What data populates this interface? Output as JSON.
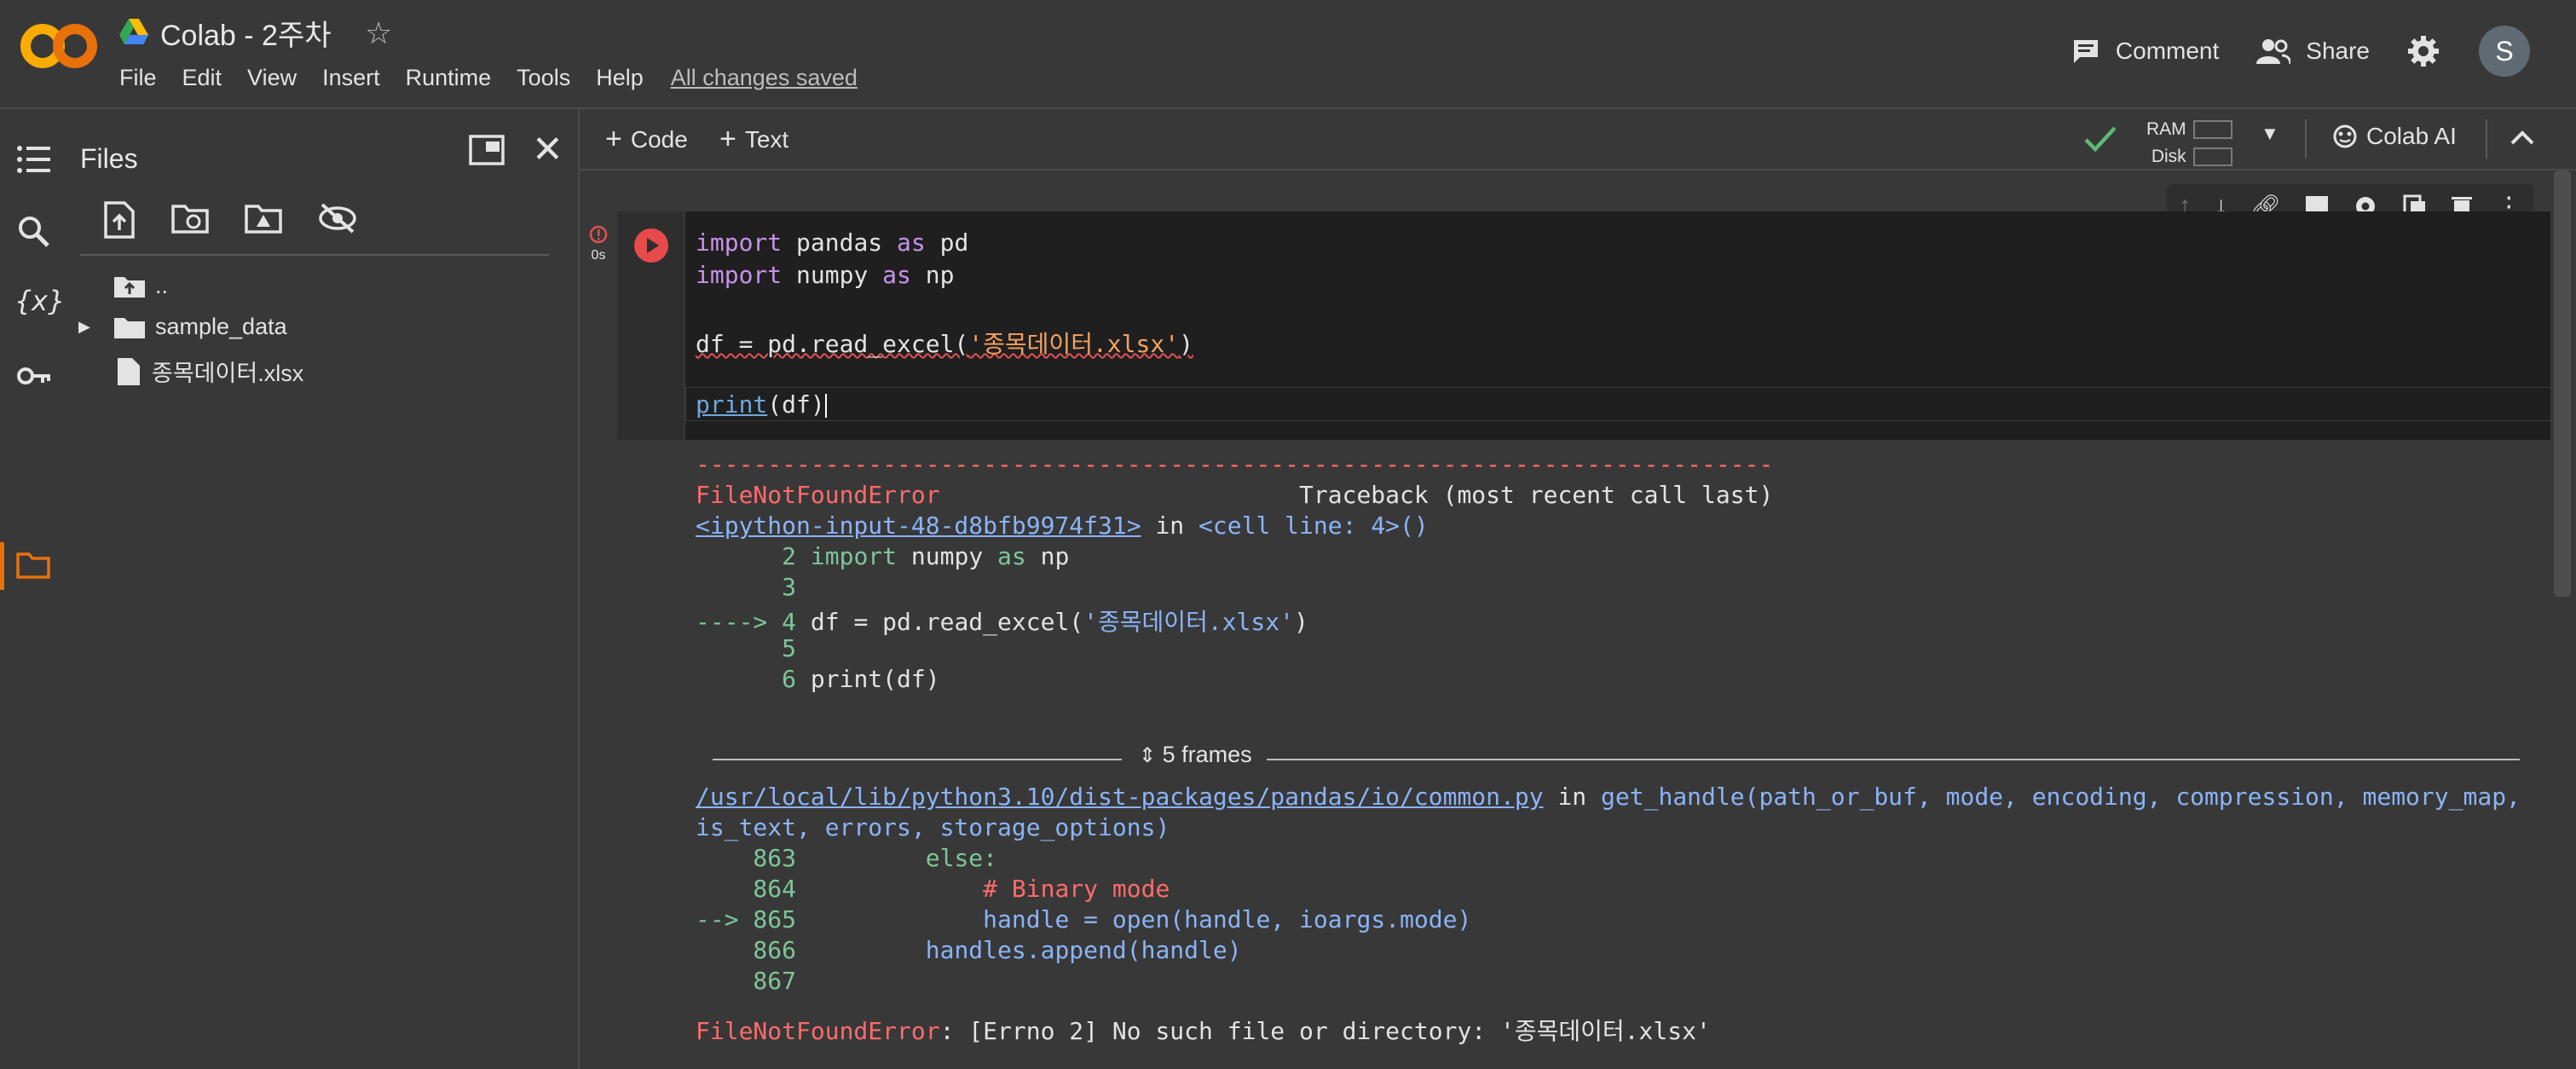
{
  "header": {
    "title": "Colab - 2주차",
    "menu": [
      "File",
      "Edit",
      "View",
      "Insert",
      "Runtime",
      "Tools",
      "Help"
    ],
    "saved_status": "All changes saved",
    "comment_label": "Comment",
    "share_label": "Share",
    "avatar_letter": "S"
  },
  "files_panel": {
    "title": "Files",
    "tree": {
      "parent": "..",
      "folder": "sample_data",
      "file": "종목데이터.xlsx"
    }
  },
  "toolbar": {
    "add_code": "Code",
    "add_text": "Text",
    "ram_label": "RAM",
    "disk_label": "Disk",
    "colab_ai": "Colab AI"
  },
  "cell": {
    "exec_time": "0s",
    "code": {
      "l1_kw": "import",
      "l1_mid": " pandas ",
      "l1_as": "as",
      "l1_end": " pd",
      "l2_kw": "import",
      "l2_mid": " numpy ",
      "l2_as": "as",
      "l2_end": " np",
      "l3_a": "df = pd.read_excel(",
      "l3_str": "'종목데이터.xlsx'",
      "l3_b": ")",
      "l4_fn": "print",
      "l4_rest": "(df)"
    }
  },
  "output": {
    "dashes": "---------------------------------------------------------------------------",
    "error_name": "FileNotFoundError",
    "traceback_hdr": "Traceback (most recent call last)",
    "input_link": "<ipython-input-48-d8bfb9974f31>",
    "in_cell": " in ",
    "cell_line": "<cell line: 4>()",
    "tb1": [
      {
        "arrow": "      ",
        "num": "2",
        "code_kw": " import",
        "code_rest": " numpy ",
        "code_as": "as",
        "code_end": " np"
      },
      {
        "arrow": "      ",
        "num": "3"
      },
      {
        "arrow": "----> ",
        "num": "4",
        "code": " df = pd.read_excel(",
        "code_str": "'종목데이터.xlsx'",
        "code_close": ")"
      },
      {
        "arrow": "      ",
        "num": "5"
      },
      {
        "arrow": "      ",
        "num": "6",
        "code": " print(df)"
      }
    ],
    "frames_label": "5 frames",
    "common_link": "/usr/local/lib/python3.10/dist-packages/pandas/io/common.py",
    "common_in": " in ",
    "common_fn": "get_handle(path_or_buf, mode, encoding, compression, memory_map,",
    "common_fn2": "is_text, errors, storage_options)",
    "tb2": [
      {
        "num": "    863",
        "code": "         else:"
      },
      {
        "num": "    864",
        "code": "             # Binary mode"
      },
      {
        "num": "--> 865",
        "code": "             handle = open(handle, ioargs.mode)"
      },
      {
        "num": "    866",
        "code": "         handles.append(handle)"
      },
      {
        "num": "    867",
        "code": ""
      }
    ],
    "final_error": "FileNotFoundError",
    "final_msg": ": [Errno 2] No such file or directory: '종목데이터.xlsx'"
  },
  "colors": {
    "accent_orange": "#e8710a",
    "error_red": "#ff6b6b",
    "link_blue": "#8ab4f8",
    "number_green": "#7ec699"
  }
}
